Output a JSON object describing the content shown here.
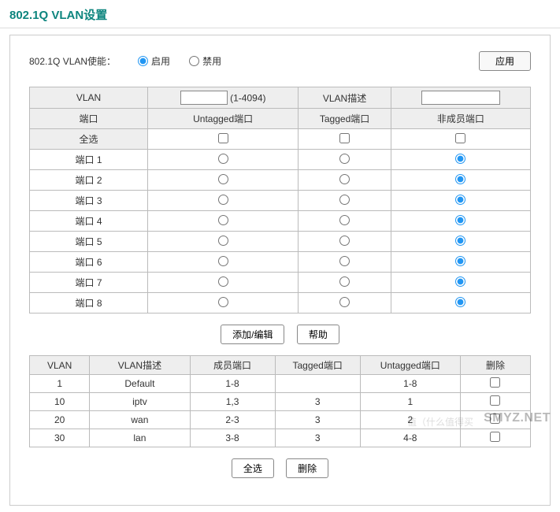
{
  "title": "802.1Q VLAN设置",
  "enable": {
    "label": "802.1Q VLAN使能：",
    "opt_enable": "启用",
    "opt_disable": "禁用",
    "value": "enable"
  },
  "buttons": {
    "apply": "应用",
    "add_edit": "添加/编辑",
    "help": "帮助",
    "select_all": "全选",
    "delete": "删除"
  },
  "config_table": {
    "headers": {
      "vlan": "VLAN",
      "vlan_id_hint": "(1-4094)",
      "vlan_desc": "VLAN描述",
      "port": "端口",
      "untagged": "Untagged端口",
      "tagged": "Tagged端口",
      "nonmember": "非成员端口",
      "select_all_row": "全选"
    },
    "vlan_id_value": "",
    "vlan_desc_value": "",
    "ports": [
      {
        "label": "端口 1",
        "sel": "nonmember"
      },
      {
        "label": "端口 2",
        "sel": "nonmember"
      },
      {
        "label": "端口 3",
        "sel": "nonmember"
      },
      {
        "label": "端口 4",
        "sel": "nonmember"
      },
      {
        "label": "端口 5",
        "sel": "nonmember"
      },
      {
        "label": "端口 6",
        "sel": "nonmember"
      },
      {
        "label": "端口 7",
        "sel": "nonmember"
      },
      {
        "label": "端口 8",
        "sel": "nonmember"
      }
    ]
  },
  "list_table": {
    "headers": {
      "vlan": "VLAN",
      "desc": "VLAN描述",
      "member": "成员端口",
      "tagged": "Tagged端口",
      "untagged": "Untagged端口",
      "delete": "删除"
    },
    "rows": [
      {
        "vlan": "1",
        "desc": "Default",
        "member": "1-8",
        "tagged": "",
        "untagged": "1-8"
      },
      {
        "vlan": "10",
        "desc": "iptv",
        "member": "1,3",
        "tagged": "3",
        "untagged": "1"
      },
      {
        "vlan": "20",
        "desc": "wan",
        "member": "2-3",
        "tagged": "3",
        "untagged": "2"
      },
      {
        "vlan": "30",
        "desc": "lan",
        "member": "3-8",
        "tagged": "3",
        "untagged": "4-8"
      }
    ]
  },
  "watermark": "SMYZ.NET",
  "watermark2": "值（什么值得买"
}
